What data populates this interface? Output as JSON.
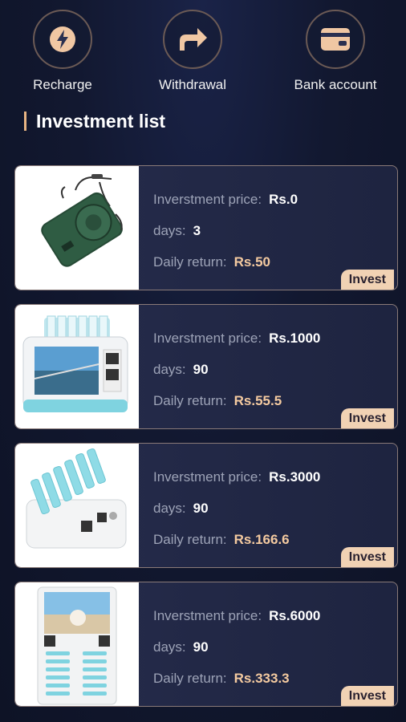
{
  "actions": [
    {
      "label": "Recharge",
      "icon": "lightning-icon"
    },
    {
      "label": "Withdrawal",
      "icon": "share-arrow-icon"
    },
    {
      "label": "Bank account",
      "icon": "wallet-card-icon"
    }
  ],
  "section_title": "Investment list",
  "labels": {
    "price": "Inverstment price:",
    "days": "days:",
    "daily": "Daily return:",
    "invest": "Invest"
  },
  "products": [
    {
      "price": "Rs.0",
      "days": "3",
      "daily": "Rs.50",
      "image": "power-bank-image"
    },
    {
      "price": "Rs.1000",
      "days": "90",
      "daily": "Rs.55.5",
      "image": "charging-station-screen-image"
    },
    {
      "price": "Rs.3000",
      "days": "90",
      "daily": "Rs.166.6",
      "image": "charging-station-slots-image"
    },
    {
      "price": "Rs.6000",
      "days": "90",
      "daily": "Rs.333.3",
      "image": "charging-kiosk-image"
    }
  ],
  "colors": {
    "accent": "#e8b483",
    "invest_bg": "#f1d2b4",
    "return_text": "#f4caa0"
  }
}
